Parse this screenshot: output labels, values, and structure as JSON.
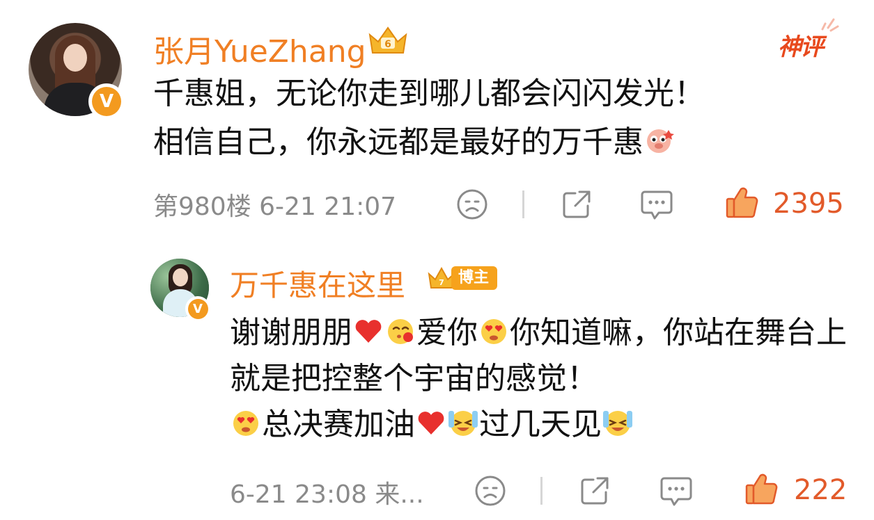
{
  "main_comment": {
    "author": "张月YueZhang",
    "avatar_icon": "user-avatar",
    "verified_badge": "V",
    "crown_icon": "fan-level-crown-icon",
    "tag": "神评",
    "content_line1": "千惠姐，无论你走到哪儿都会闪闪发光！",
    "content_line2": "相信自己，你永远都是最好的万千惠",
    "floor_and_time": "第980楼 6-21 21:07",
    "likes": "2395",
    "colors": {
      "name": "#f07f24",
      "tag": "#e8491d",
      "like": "#e25a2a"
    }
  },
  "reply": {
    "author": "万千惠在这里",
    "verified_badge": "V",
    "role_badge": "博主",
    "content_part1": "谢谢朋朋",
    "content_part2": "爱你",
    "content_part3": "你知道嘛，你站在舞台上就是把控整个宇宙的感觉！",
    "content_part4": "总决赛加油",
    "content_part5": "过几天见",
    "time_and_source": "6-21 23:08  来...",
    "likes": "222"
  }
}
